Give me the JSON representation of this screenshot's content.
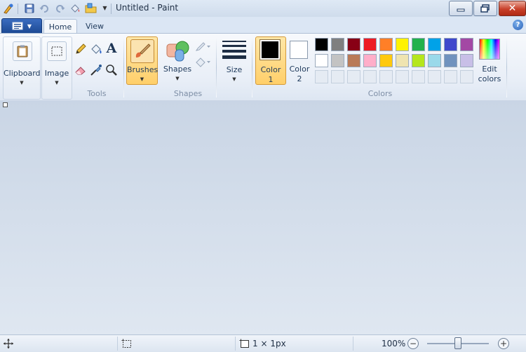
{
  "window": {
    "title": "Untitled - Paint",
    "minimize_icon": "minimize-icon",
    "maximize_icon": "maximize-icon",
    "close_icon": "close-icon"
  },
  "quick_access": {
    "items": [
      "paint-app-icon",
      "save-icon",
      "undo-icon",
      "redo-icon",
      "paint-bucket-icon",
      "folder-icon",
      "customize-dropdown-icon"
    ]
  },
  "tabs": {
    "home": "Home",
    "view": "View"
  },
  "ribbon": {
    "clipboard": {
      "label": "Clipboard"
    },
    "image": {
      "label": "Image"
    },
    "tools": {
      "group_label": "Tools",
      "items": [
        "pencil-icon",
        "fill-icon",
        "text-icon",
        "eraser-icon",
        "color-picker-icon",
        "magnifier-icon"
      ]
    },
    "brushes": {
      "label": "Brushes"
    },
    "shapes": {
      "label": "Shapes",
      "group_label": "Shapes",
      "outline_icon": "outline-icon",
      "fill_icon": "shape-fill-icon"
    },
    "size": {
      "label": "Size"
    },
    "colors": {
      "color1_label": "Color",
      "color1_num": "1",
      "color2_label": "Color",
      "color2_num": "2",
      "color1_value": "#000000",
      "color2_value": "#ffffff",
      "group_label": "Colors",
      "edit_label_1": "Edit",
      "edit_label_2": "colors",
      "palette_row1": [
        "#000000",
        "#7f7f7f",
        "#880015",
        "#ed1c24",
        "#ff7f27",
        "#fff200",
        "#22b14c",
        "#00a2e8",
        "#3f48cc",
        "#a349a4"
      ],
      "palette_row2": [
        "#ffffff",
        "#c3c3c3",
        "#b97a57",
        "#ffaec9",
        "#ffc90e",
        "#efe4b0",
        "#b5e61d",
        "#99d9ea",
        "#7092be",
        "#c8bfe7"
      ]
    }
  },
  "status": {
    "dimensions": "1 × 1px",
    "zoom": "100%",
    "zoom_level": 0.5
  }
}
